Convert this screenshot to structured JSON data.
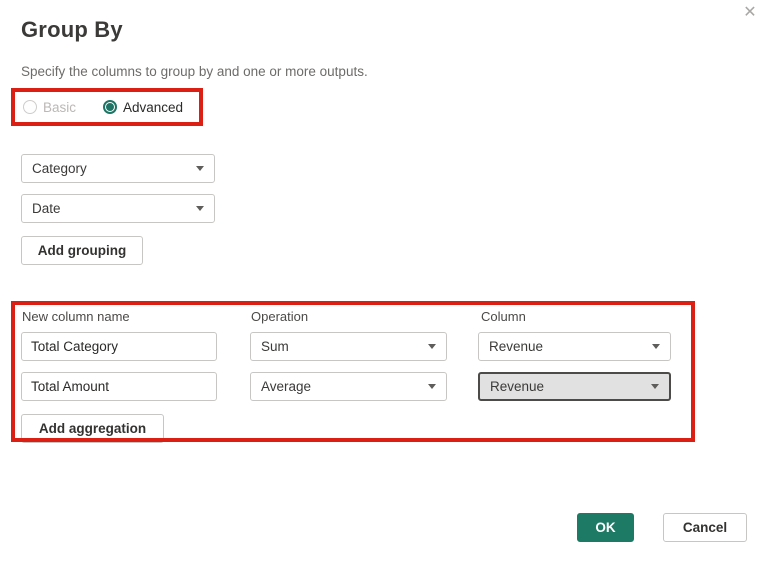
{
  "dialog": {
    "title": "Group By",
    "subtitle": "Specify the columns to group by and one or more outputs.",
    "close_icon": "✕"
  },
  "mode": {
    "basic": {
      "label": "Basic",
      "selected": false,
      "disabled": true
    },
    "advanced": {
      "label": "Advanced",
      "selected": true,
      "disabled": false
    }
  },
  "grouping": {
    "dropdowns": [
      {
        "value": "Category"
      },
      {
        "value": "Date"
      }
    ],
    "add_button_label": "Add grouping"
  },
  "aggregations": {
    "headers": [
      "New column name",
      "Operation",
      "Column"
    ],
    "rows": [
      {
        "name": "Total Category",
        "operation": "Sum",
        "column": "Revenue",
        "column_focused": false
      },
      {
        "name": "Total Amount",
        "operation": "Average",
        "column": "Revenue",
        "column_focused": true
      }
    ],
    "add_button_label": "Add aggregation"
  },
  "footer": {
    "ok_label": "OK",
    "cancel_label": "Cancel"
  },
  "colors": {
    "accent_teal_green": "#1d7a64",
    "annotation_red": "#dc1f15",
    "focused_dropdown_bg": "#e1e1e1",
    "border_gray": "#c8c6c4"
  }
}
